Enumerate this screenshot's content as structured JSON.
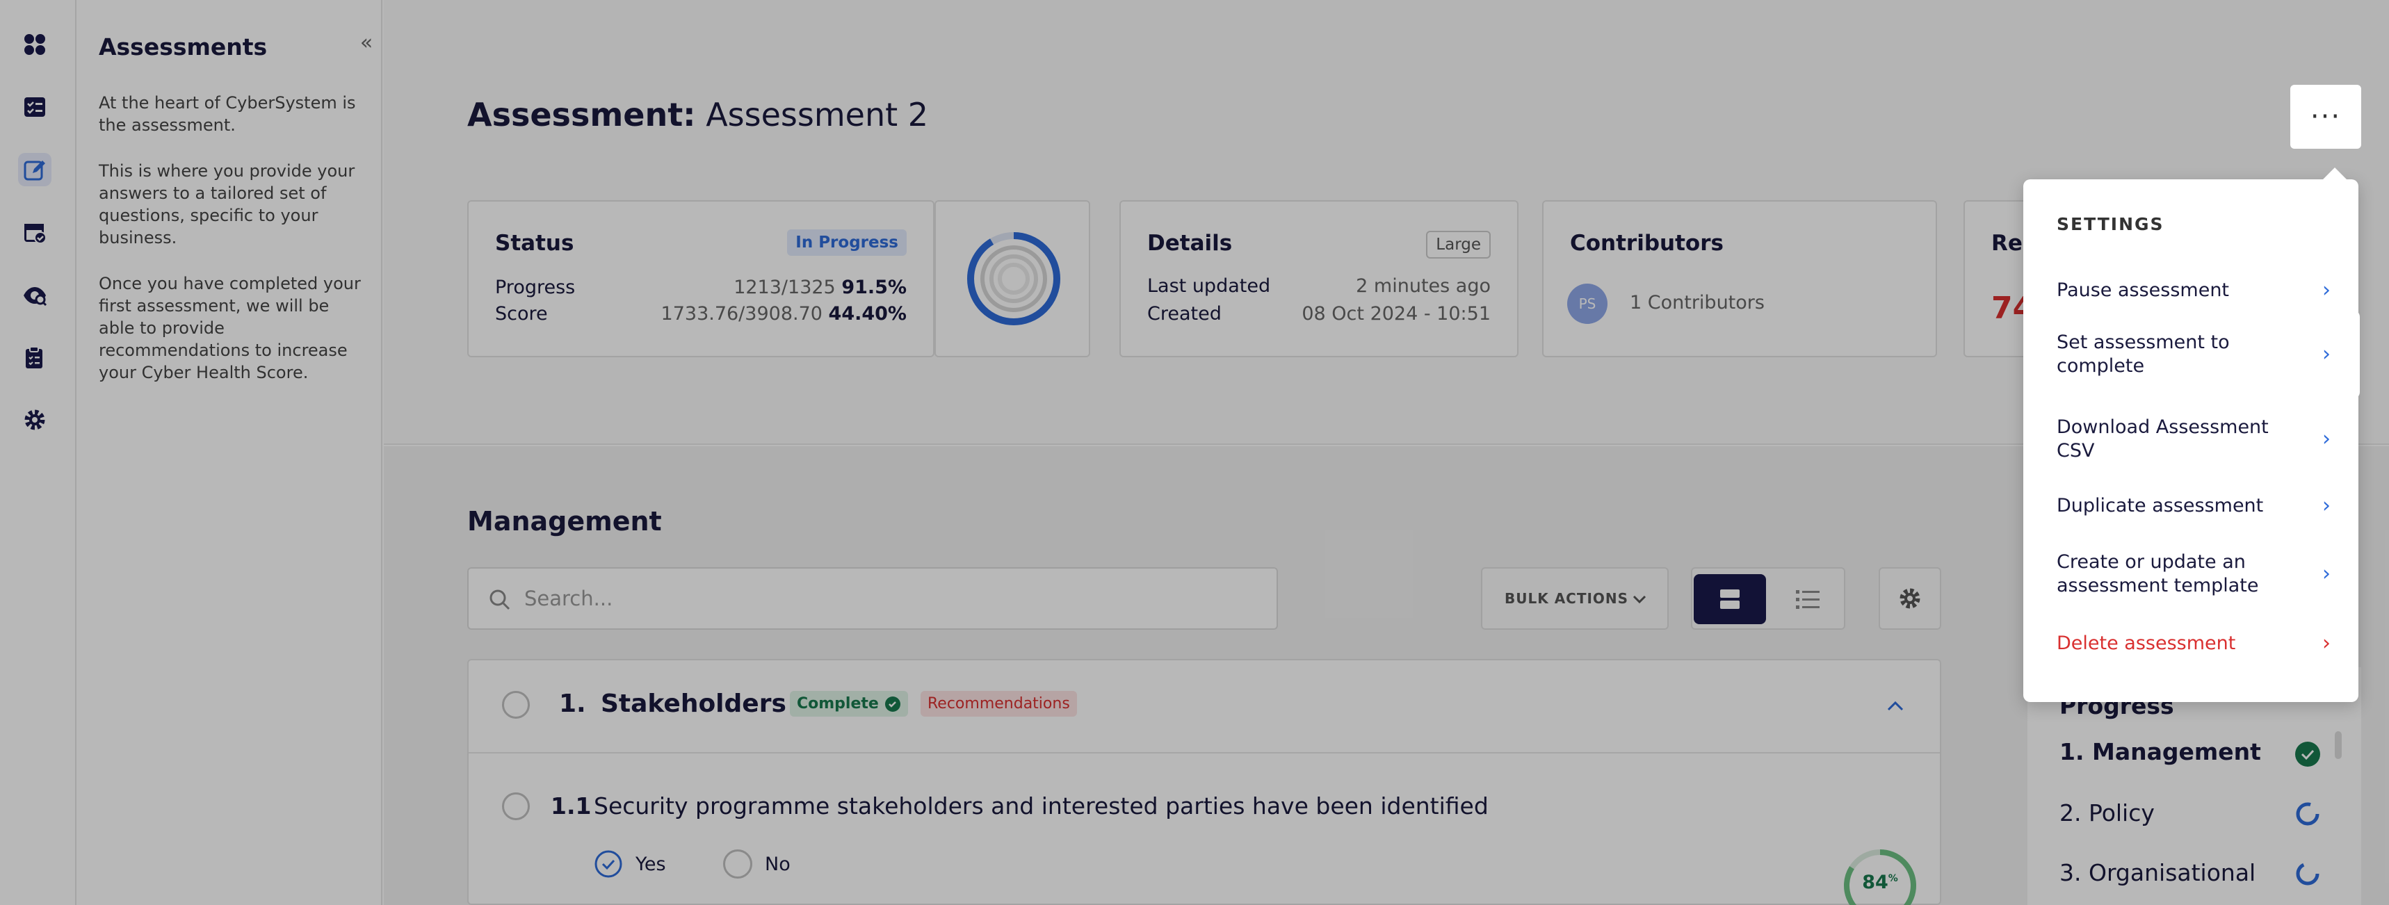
{
  "iconbar": {
    "items": [
      "apps-icon",
      "checklist-icon",
      "edit-icon",
      "calendar-check-icon",
      "search-user-icon",
      "clipboard-icon",
      "settings-icon"
    ]
  },
  "sidebar": {
    "title": "Assessments",
    "collapse": "«",
    "para1": "At the heart of CyberSystem is the assessment.",
    "para2": "This is where you provide your answers to a tailored set of questions, specific to your business.",
    "para3": "Once you have completed your first assessment, we will be able to provide recommendations to increase your Cyber Health Score."
  },
  "header": {
    "title_label": "Assessment:",
    "title_value": "Assessment 2",
    "more": "···"
  },
  "status_card": {
    "title": "Status",
    "badge": "In Progress",
    "progress_label": "Progress",
    "progress_counts": "1213/1325",
    "progress_pct": "91.5%",
    "score_label": "Score",
    "score_counts": "1733.76/3908.70",
    "score_pct": "44.40%",
    "progress_fraction": 0.915
  },
  "details_card": {
    "title": "Details",
    "badge": "Large",
    "updated_label": "Last updated",
    "updated_value": "2 minutes ago",
    "created_label": "Created",
    "created_value": "08 Oct 2024 - 10:51"
  },
  "contributors_card": {
    "title": "Contributors",
    "avatar": "PS",
    "count_text": "1 Contributors"
  },
  "rec_card": {
    "title": "Re",
    "value": "74"
  },
  "management": {
    "title": "Management",
    "search_placeholder": "Search...",
    "bulk_label": "BULK ACTIONS",
    "section_num": "1.",
    "section_title": "Stakeholders",
    "complete_badge": "Complete",
    "rec_badge": "Recommendations",
    "q_num": "1.1",
    "q_text": "Security programme stakeholders and interested parties have been identified",
    "yes": "Yes",
    "no": "No",
    "q_score": "84",
    "q_score_unit": "%"
  },
  "right_nav": {
    "heading": "Progress",
    "items": [
      "1. Management",
      "2. Policy",
      "3. Organisational"
    ]
  },
  "menu": {
    "heading": "SETTINGS",
    "items": [
      {
        "label": "Pause assessment"
      },
      {
        "label": "Set assessment to complete"
      },
      {
        "label": "Download Assessment CSV"
      },
      {
        "label": "Duplicate assessment"
      },
      {
        "label": "Create or update an assessment template"
      },
      {
        "label": "Delete assessment"
      }
    ]
  },
  "colors": {
    "accent": "#2e6bd9",
    "navy": "#1a1a4b",
    "danger": "#d93030",
    "success": "#18794e"
  }
}
